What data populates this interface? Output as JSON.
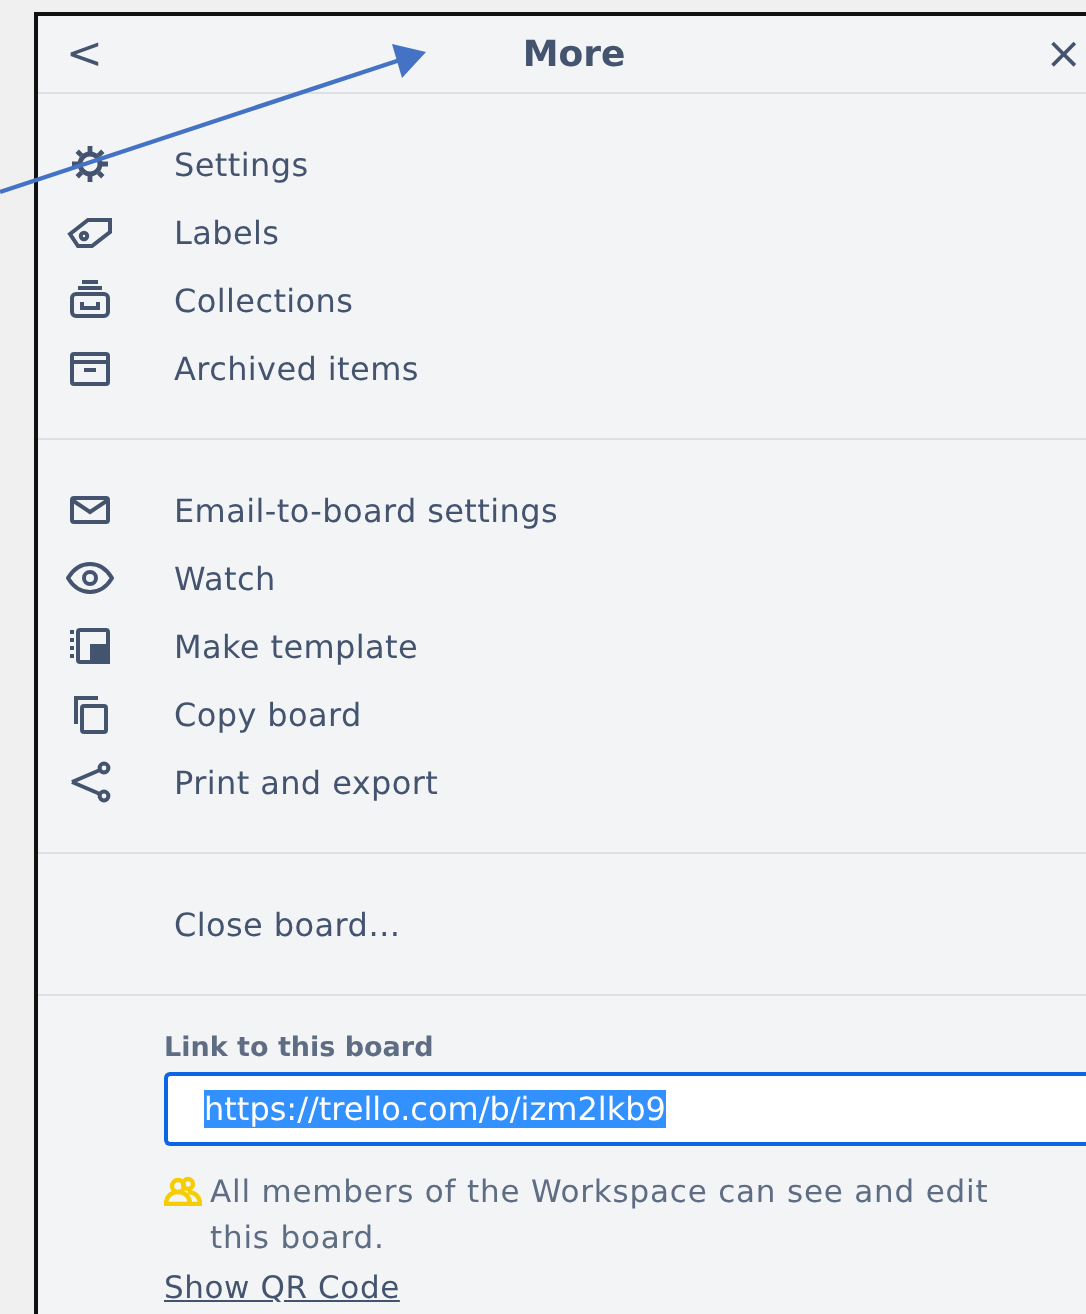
{
  "header": {
    "back": "<",
    "title": "More",
    "close": "×"
  },
  "groups": [
    {
      "items": [
        {
          "kind": "gear",
          "label": "Settings"
        },
        {
          "kind": "tag",
          "label": "Labels"
        },
        {
          "kind": "stack",
          "label": "Collections"
        },
        {
          "kind": "archive",
          "label": "Archived items"
        }
      ]
    },
    {
      "items": [
        {
          "kind": "mail",
          "label": "Email-to-board settings"
        },
        {
          "kind": "eye",
          "label": "Watch"
        },
        {
          "kind": "template",
          "label": "Make template"
        },
        {
          "kind": "copy",
          "label": "Copy board"
        },
        {
          "kind": "share",
          "label": "Print and export"
        }
      ]
    },
    {
      "items": [
        {
          "kind": "none",
          "label": "Close board…"
        }
      ]
    }
  ],
  "link": {
    "label": "Link to this board",
    "value": "https://trello.com/b/izm2lkb9",
    "value_selected": true,
    "note": "All members of the Workspace can see and edit this board.",
    "qr_link": "Show QR Code"
  }
}
